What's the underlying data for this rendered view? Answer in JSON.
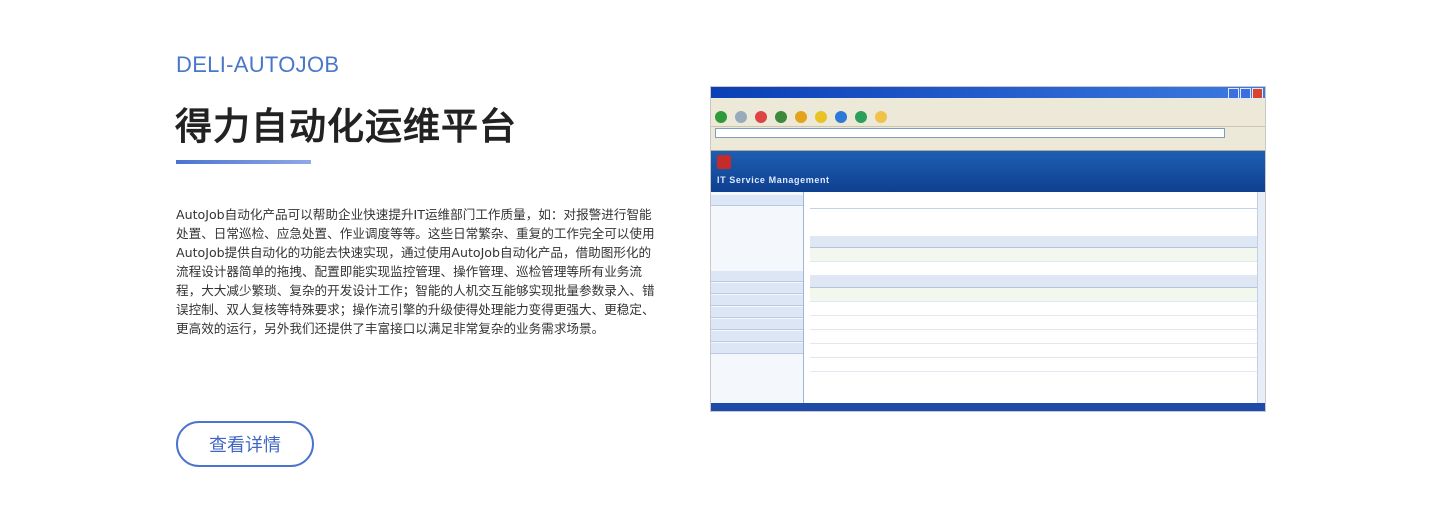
{
  "eyebrow": "DELI-AUTOJOB",
  "title": "得力自动化运维平台",
  "description": "AutoJob自动化产品可以帮助企业快速提升IT运维部门工作质量，如：对报警进行智能处置、日常巡检、应急处置、作业调度等等。这些日常繁杂、重复的工作完全可以使用AutoJob提供自动化的功能去快速实现，通过使用AutoJob自动化产品，借助图形化的流程设计器简单的拖拽、配置即能实现监控管理、操作管理、巡检管理等所有业务流程，大大减少繁琐、复杂的开发设计工作；智能的人机交互能够实现批量参数录入、错误控制、双人复核等特殊要求；操作流引擎的升级使得处理能力变得更强大、更稳定、更高效的运行，另外我们还提供了丰富接口以满足非常复杂的业务需求场景。",
  "button_label": "查看详情",
  "screenshot": {
    "banner_text": "IT Service Management",
    "colors": {
      "banner": "#1d5fb3",
      "accent": "#4b74d0",
      "titlebar": "#0b3fb5"
    }
  }
}
